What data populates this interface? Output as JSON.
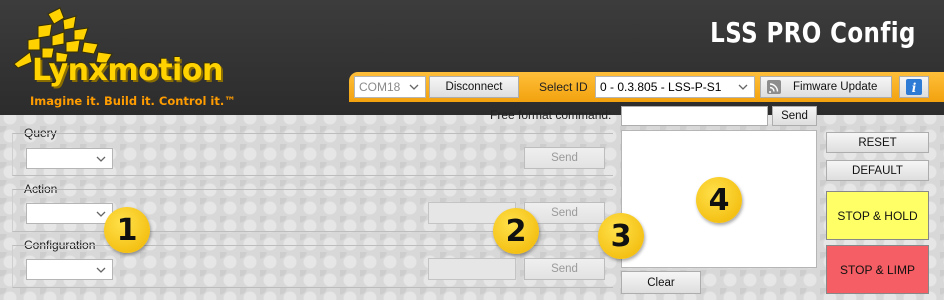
{
  "header": {
    "title": "LSS PRO Config",
    "logo": {
      "name": "Lynxmotion",
      "tagline": "Imagine it.  Build it.  Control it.™"
    }
  },
  "toolbar": {
    "port": {
      "value": "COM18"
    },
    "connect_label": "Disconnect",
    "select_id_label": "Select ID",
    "select_id_value": "0 - 0.3.805 - LSS-P-S1",
    "firmware_label": "Fimware Update",
    "info_icon": "info-icon"
  },
  "free_format": {
    "label": "Free format command:",
    "value": "",
    "send_label": "Send"
  },
  "query": {
    "label": "Query",
    "select_value": "",
    "send_label": "Send"
  },
  "action": {
    "label": "Action",
    "select_value": "",
    "input_value": "",
    "send_label": "Send"
  },
  "configuration": {
    "label": "Configuration",
    "select_value": "",
    "input_value": "",
    "send_label": "Send"
  },
  "output": {
    "text": "",
    "clear_label": "Clear"
  },
  "side_buttons": {
    "reset": "RESET",
    "default": "DEFAULT",
    "stop_hold": "STOP & HOLD",
    "stop_limp": "STOP & LIMP"
  },
  "markers": [
    "1",
    "2",
    "3",
    "4"
  ],
  "colors": {
    "header_bg": "#2f2f2f",
    "toolbar_orange": "#f7a81b",
    "logo_yellow": "#ffd200",
    "stop_hold": "#ffff66",
    "stop_limp": "#f55e64",
    "marker_yellow": "#f7c21a"
  }
}
